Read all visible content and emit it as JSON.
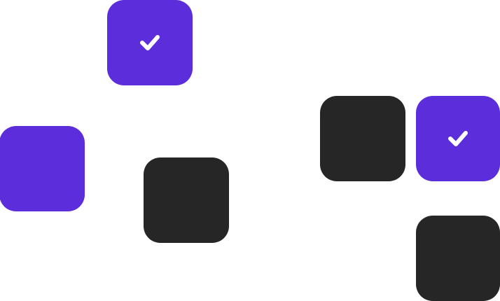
{
  "tiles": [
    {
      "id": "t1",
      "checked": true,
      "color": "#5b2ddb",
      "icon": "check-icon"
    },
    {
      "id": "t2",
      "checked": false,
      "color": "#5b2ddb",
      "icon": ""
    },
    {
      "id": "t3",
      "checked": false,
      "color": "#262626",
      "icon": ""
    },
    {
      "id": "t4",
      "checked": false,
      "color": "#262626",
      "icon": ""
    },
    {
      "id": "t5",
      "checked": true,
      "color": "#5b2ddb",
      "icon": "check-icon"
    },
    {
      "id": "t6",
      "checked": false,
      "color": "#262626",
      "icon": ""
    }
  ],
  "colors": {
    "accent": "#5b2ddb",
    "dark": "#262626",
    "check": "#ffffff",
    "background": "#ffffff"
  }
}
